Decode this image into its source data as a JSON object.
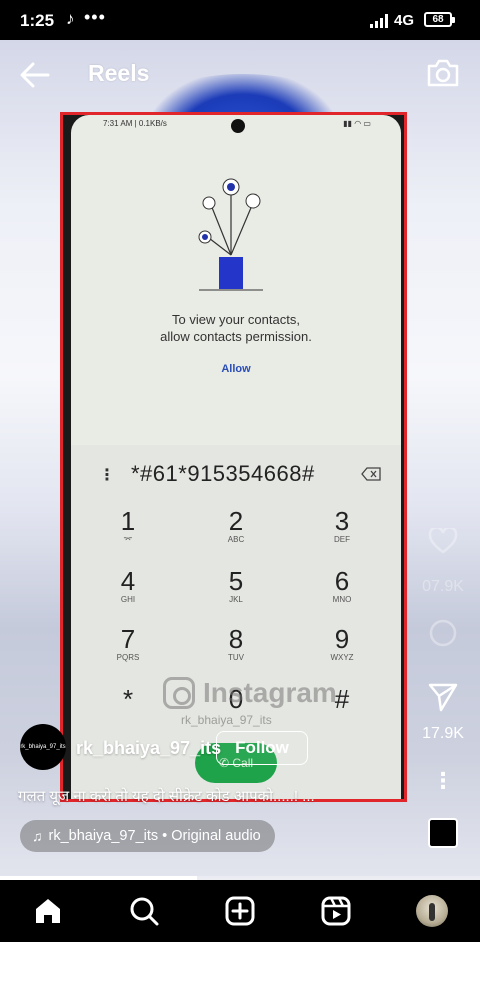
{
  "status_bar": {
    "time": "1:25",
    "network": "4G",
    "battery": "68"
  },
  "header": {
    "title": "Reels"
  },
  "video": {
    "phone_status_left": "7:31 AM | 0.1KB/s",
    "permission_text_line1": "To view your contacts,",
    "permission_text_line2": "allow contacts permission.",
    "allow_label": "Allow",
    "dialed_number": "*#61*915354668#",
    "keys": [
      {
        "num": "1",
        "letters": "⌤"
      },
      {
        "num": "2",
        "letters": "ABC"
      },
      {
        "num": "3",
        "letters": "DEF"
      },
      {
        "num": "4",
        "letters": "GHI"
      },
      {
        "num": "5",
        "letters": "JKL"
      },
      {
        "num": "6",
        "letters": "MNO"
      },
      {
        "num": "7",
        "letters": "PQRS"
      },
      {
        "num": "8",
        "letters": "TUV"
      },
      {
        "num": "9",
        "letters": "WXYZ"
      },
      {
        "num": "*",
        "letters": ""
      },
      {
        "num": "0",
        "letters": ""
      },
      {
        "num": "#",
        "letters": ""
      }
    ],
    "watermark": "Instagram",
    "watermark_handle": "rk_bhaiya_97_its",
    "call_label": "Call"
  },
  "actions": {
    "likes_count": "07.9K",
    "shares_count": "17.9K"
  },
  "reel_info": {
    "avatar_text": "rk_bhaiya_97_its",
    "username": "rk_bhaiya_97_its",
    "follow_label": "Follow",
    "caption": "गलत यूज ना करो तो यह दो सीक्रेट कोड आपको.....! ...",
    "audio_label": "rk_bhaiya_97_its • Original audio",
    "progress": 0.41
  },
  "bottom_nav": {
    "items": [
      "home-icon",
      "search-icon",
      "create-icon",
      "reels-icon",
      "profile-avatar"
    ]
  }
}
